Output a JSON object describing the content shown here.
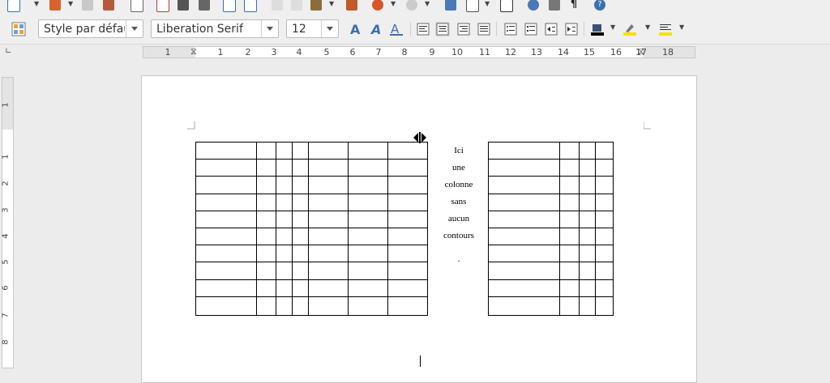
{
  "toolbar": {
    "paragraph_style": "Style par défaut",
    "font_name": "Liberation Serif",
    "font_size": "12"
  },
  "ruler": {
    "h_numbers": [
      "1",
      "1",
      "2",
      "3",
      "4",
      "5",
      "6",
      "7",
      "8",
      "9",
      "10",
      "11",
      "12",
      "13",
      "14",
      "15",
      "16",
      "17",
      "18"
    ],
    "v_numbers": [
      "1",
      "1",
      "2",
      "3",
      "4",
      "5",
      "6",
      "7",
      "8"
    ]
  },
  "document": {
    "middle_column_lines": [
      "Ici",
      "une",
      "colonne",
      "sans",
      "aucun",
      "contours",
      "."
    ],
    "left_table": {
      "rows": 10,
      "cols": 7
    },
    "right_table": {
      "rows": 10,
      "cols": 4
    }
  }
}
